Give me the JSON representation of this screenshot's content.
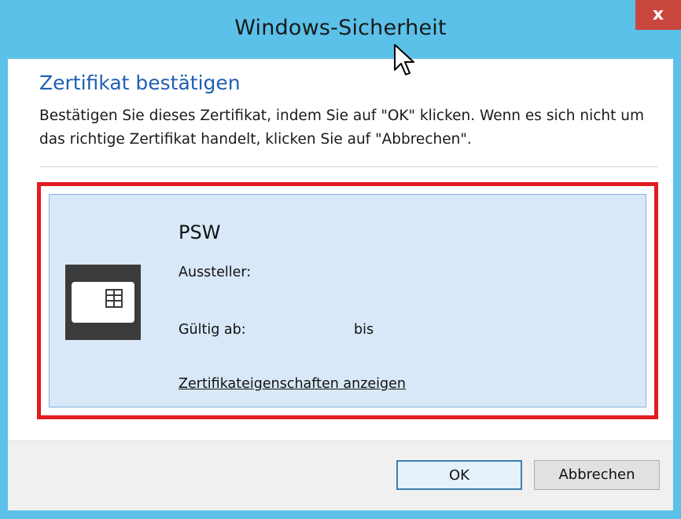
{
  "window": {
    "title": "Windows-Sicherheit",
    "close_label": "x",
    "accent_color": "#5bc1e8",
    "close_color": "#c9463d"
  },
  "dialog": {
    "heading": "Zertifikat bestätigen",
    "description": "Bestätigen Sie dieses Zertifikat, indem Sie auf \"OK\" klicken. Wenn es sich nicht um das richtige Zertifikat handelt, klicken Sie auf \"Abbrechen\"."
  },
  "certificate": {
    "name": "PSW",
    "issuer_label": "Aussteller:",
    "valid_from_label": "Gültig ab:",
    "valid_to_label": "bis",
    "properties_link": "Zertifikateigenschaften anzeigen",
    "icon": "smartcard-icon",
    "highlight_color": "#e11b22"
  },
  "buttons": {
    "ok_label": "OK",
    "cancel_label": "Abbrechen"
  }
}
